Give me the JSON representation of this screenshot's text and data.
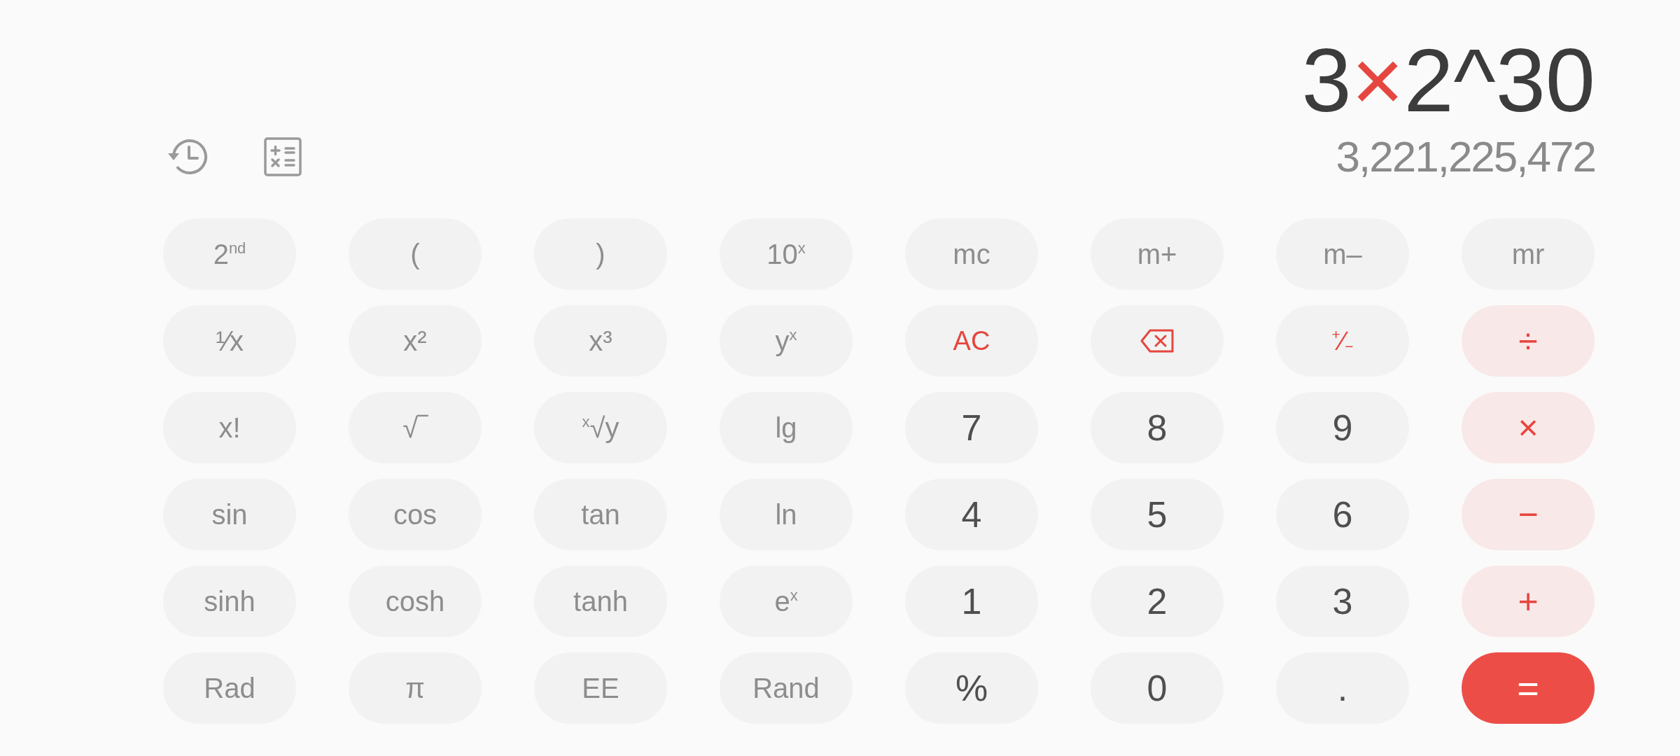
{
  "display": {
    "expression": [
      {
        "text": "3",
        "kind": "operand"
      },
      {
        "text": "×",
        "kind": "operator"
      },
      {
        "text": "2^30",
        "kind": "operand"
      }
    ],
    "result": "3,221,225,472"
  },
  "keys": [
    {
      "label": "2$^{nd}$",
      "kind": "function"
    },
    {
      "label": "(",
      "kind": "function"
    },
    {
      "label": ")",
      "kind": "function"
    },
    {
      "label": "10$^{x}$",
      "kind": "function"
    },
    {
      "label": "mc",
      "kind": "function"
    },
    {
      "label": "m+",
      "kind": "function"
    },
    {
      "label": "m–",
      "kind": "function"
    },
    {
      "label": "mr",
      "kind": "function"
    },
    {
      "label": "¹⁄x",
      "kind": "function"
    },
    {
      "label": "x²",
      "kind": "function"
    },
    {
      "label": "x³",
      "kind": "function"
    },
    {
      "label": "y$^{x}$",
      "kind": "function"
    },
    {
      "label": "AC",
      "kind": "action"
    },
    {
      "kind": "backspace"
    },
    {
      "label": "$^{+}$∕$_{−}$",
      "kind": "action"
    },
    {
      "label": "÷",
      "kind": "operator"
    },
    {
      "label": "x!",
      "kind": "function"
    },
    {
      "label": "√‾",
      "kind": "function"
    },
    {
      "label": "$^{x}$√y",
      "kind": "function"
    },
    {
      "label": "lg",
      "kind": "function"
    },
    {
      "label": "7",
      "kind": "digit"
    },
    {
      "label": "8",
      "kind": "digit"
    },
    {
      "label": "9",
      "kind": "digit"
    },
    {
      "label": "×",
      "kind": "operator"
    },
    {
      "label": "sin",
      "kind": "function"
    },
    {
      "label": "cos",
      "kind": "function"
    },
    {
      "label": "tan",
      "kind": "function"
    },
    {
      "label": "ln",
      "kind": "function"
    },
    {
      "label": "4",
      "kind": "digit"
    },
    {
      "label": "5",
      "kind": "digit"
    },
    {
      "label": "6",
      "kind": "digit"
    },
    {
      "label": "−",
      "kind": "operator"
    },
    {
      "label": "sinh",
      "kind": "function"
    },
    {
      "label": "cosh",
      "kind": "function"
    },
    {
      "label": "tanh",
      "kind": "function"
    },
    {
      "label": "e$^{x}$",
      "kind": "function"
    },
    {
      "label": "1",
      "kind": "digit"
    },
    {
      "label": "2",
      "kind": "digit"
    },
    {
      "label": "3",
      "kind": "digit"
    },
    {
      "label": "+",
      "kind": "operator"
    },
    {
      "label": "Rad",
      "kind": "function"
    },
    {
      "label": "π",
      "kind": "function"
    },
    {
      "label": "EE",
      "kind": "function"
    },
    {
      "label": "Rand",
      "kind": "function"
    },
    {
      "label": "%",
      "kind": "digit"
    },
    {
      "label": "0",
      "kind": "digit"
    },
    {
      "label": ".",
      "kind": "digit"
    },
    {
      "label": "=",
      "kind": "equals"
    }
  ]
}
